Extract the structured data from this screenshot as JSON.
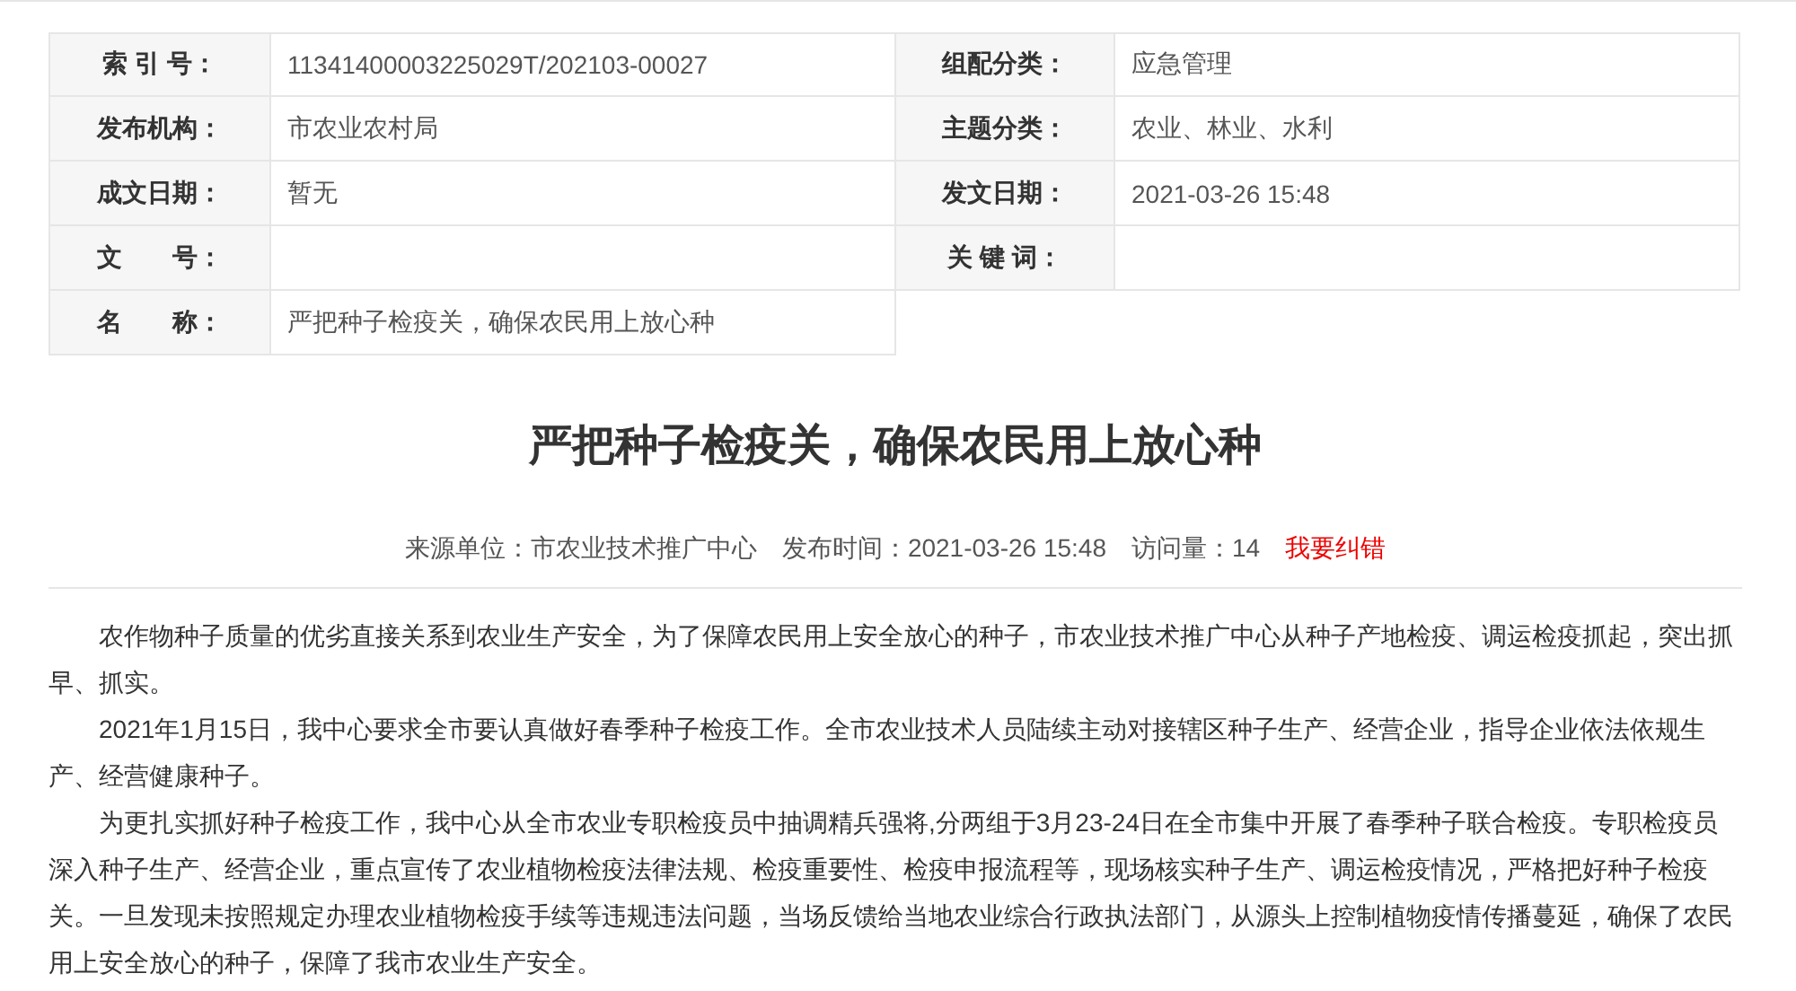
{
  "info_table": {
    "rows": [
      {
        "cells": [
          {
            "label": "索 引 号：",
            "value": "11341400003225029T/202103-00027"
          },
          {
            "label": "组配分类：",
            "value": "应急管理"
          }
        ]
      },
      {
        "cells": [
          {
            "label": "发布机构：",
            "value": "市农业农村局"
          },
          {
            "label": "主题分类：",
            "value": "农业、林业、水利"
          }
        ]
      },
      {
        "cells": [
          {
            "label": "成文日期：",
            "value": "暂无"
          },
          {
            "label": "发文日期：",
            "value": "2021-03-26 15:48"
          }
        ]
      },
      {
        "cells": [
          {
            "label": "文　　号："
          },
          {
            "label": "关 键 词："
          }
        ]
      },
      {
        "cells": [
          {
            "label": "名　　称：",
            "value": "严把种子检疫关，确保农民用上放心种"
          }
        ]
      }
    ]
  },
  "article": {
    "title": "严把种子检疫关，确保农民用上放心种",
    "meta": [
      {
        "kind": "text",
        "text": "来源单位：市农业技术推广中心"
      },
      {
        "kind": "text",
        "text": "发布时间：2021-03-26 15:48"
      },
      {
        "kind": "text",
        "text": "访问量：14"
      },
      {
        "kind": "link",
        "text": "我要纠错"
      }
    ],
    "paragraphs": [
      "农作物种子质量的优劣直接关系到农业生产安全，为了保障农民用上安全放心的种子，市农业技术推广中心从种子产地检疫、调运检疫抓起，突出抓早、抓实。",
      "2021年1月15日，我中心要求全市要认真做好春季种子检疫工作。全市农业技术人员陆续主动对接辖区种子生产、经营企业，指导企业依法依规生产、经营健康种子。",
      "为更扎实抓好种子检疫工作，我中心从全市农业专职检疫员中抽调精兵强将,分两组于3月23-24日在全市集中开展了春季种子联合检疫。专职检疫员深入种子生产、经营企业，重点宣传了农业植物检疫法律法规、检疫重要性、检疫申报流程等，现场核实种子生产、调运检疫情况，严格把好种子检疫关。一旦发现未按照规定办理农业植物检疫手续等违规违法问题，当场反馈给当地农业综合行政执法部门，从源头上控制植物疫情传播蔓延，确保了农民用上安全放心的种子，保障了我市农业生产安全。"
    ]
  }
}
